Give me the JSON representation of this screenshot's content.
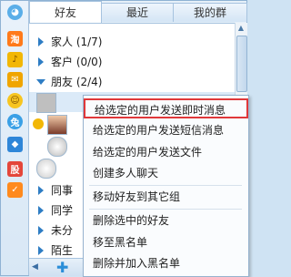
{
  "tabs": [
    "好友",
    "最近",
    "我的群"
  ],
  "groups_top": [
    {
      "label": "家人 (1/7)",
      "expanded": false
    },
    {
      "label": "客户 (0/0)",
      "expanded": false
    },
    {
      "label": "朋友 (2/4)",
      "expanded": true
    }
  ],
  "groups_bottom": [
    "同事",
    "同学",
    "未分",
    "陌生"
  ],
  "menu": {
    "items": [
      "给选定的用户发送即时消息",
      "给选定的用户发送短信消息",
      "给选定的用户发送文件",
      "创建多人聊天",
      "移动好友到其它组",
      "删除选中的好友",
      "移至黑名单",
      "删除并加入黑名单"
    ],
    "selected_index": 0
  },
  "leftbar_icons": [
    "cat-icon",
    "taobao-icon",
    "bell-icon",
    "mail-icon",
    "smile-icon",
    "blue-circle-icon",
    "qq-icon",
    "stock-icon",
    "shield-icon"
  ],
  "colors": {
    "highlight_border": "#e0383a",
    "accent": "#2e7dc4"
  }
}
